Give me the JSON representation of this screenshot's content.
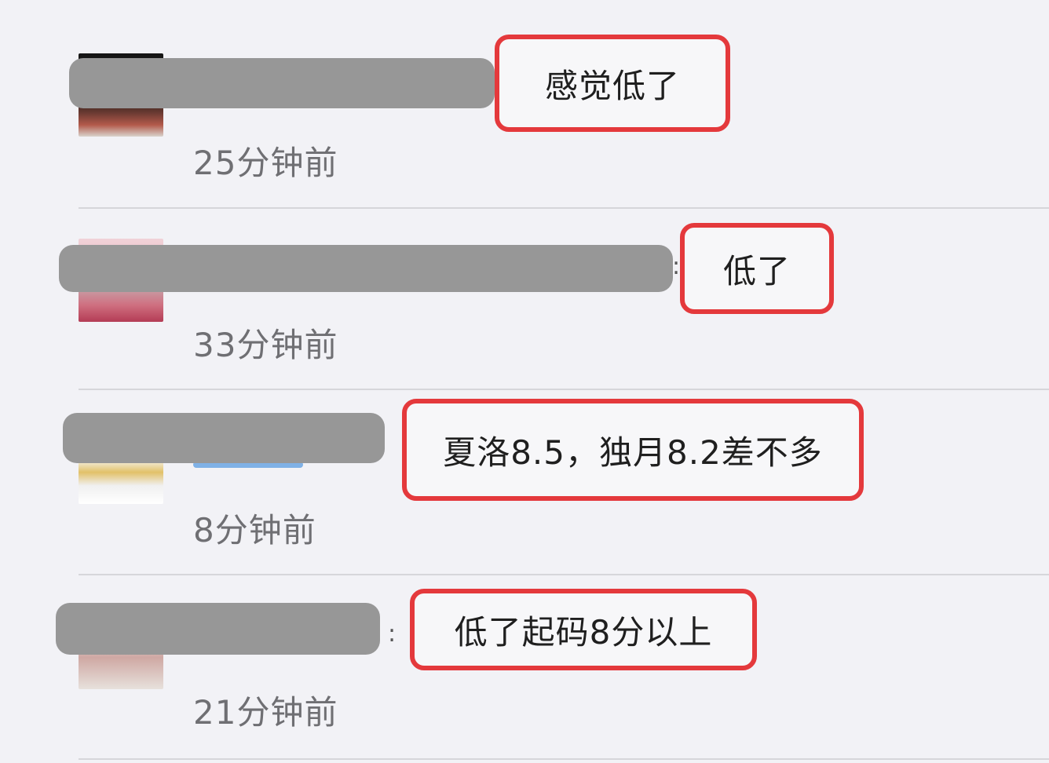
{
  "comments": [
    {
      "message": "感觉低了",
      "time": "25分钟前"
    },
    {
      "message": "低了",
      "time": "33分钟前"
    },
    {
      "message": "夏洛8.5，独月8.2差不多",
      "time": "8分钟前"
    },
    {
      "message": "低了起码8分以上",
      "time": "21分钟前"
    }
  ],
  "separator": ":",
  "colors": {
    "highlight": "#e4393c",
    "redaction": "#979797",
    "background": "#f2f2f6",
    "timestamp": "#6f6f73"
  }
}
